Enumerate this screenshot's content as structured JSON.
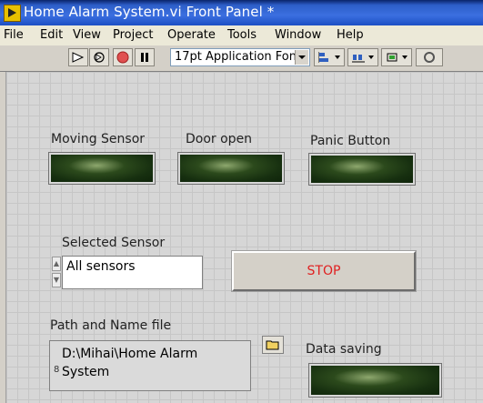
{
  "window": {
    "title": "Home Alarm System.vi Front Panel *"
  },
  "menu": {
    "items": [
      {
        "label": "File"
      },
      {
        "label": "Edit"
      },
      {
        "label": "View"
      },
      {
        "label": "Project"
      },
      {
        "label": "Operate"
      },
      {
        "label": "Tools"
      },
      {
        "label": "Window"
      },
      {
        "label": "Help"
      }
    ]
  },
  "toolbar": {
    "font": "17pt Application Font",
    "buttons": [
      {
        "icon": "run-arrow-icon"
      },
      {
        "icon": "run-continuously-icon"
      },
      {
        "icon": "abort-icon"
      },
      {
        "icon": "pause-icon"
      },
      {
        "icon": "align-objects-icon"
      },
      {
        "icon": "distribute-objects-icon"
      },
      {
        "icon": "resize-objects-icon"
      },
      {
        "icon": "reorder-icon"
      }
    ]
  },
  "panel": {
    "leds": [
      {
        "label": "Moving Sensor"
      },
      {
        "label": "Door open"
      },
      {
        "label": "Panic Button"
      }
    ],
    "selected_sensor": {
      "label": "Selected Sensor",
      "value": "All sensors"
    },
    "stop_button": {
      "label": "STOP"
    },
    "path": {
      "label": "Path and Name file",
      "prefix": "8",
      "value": "D:\\Mihai\\Home Alarm System"
    },
    "data_saving": {
      "label": "Data saving"
    }
  },
  "colors": {
    "titlebar": "#2d5ec8",
    "led_off": "#1a3412",
    "stop_text": "#e02020",
    "panel_bg": "#d6d6d6"
  }
}
